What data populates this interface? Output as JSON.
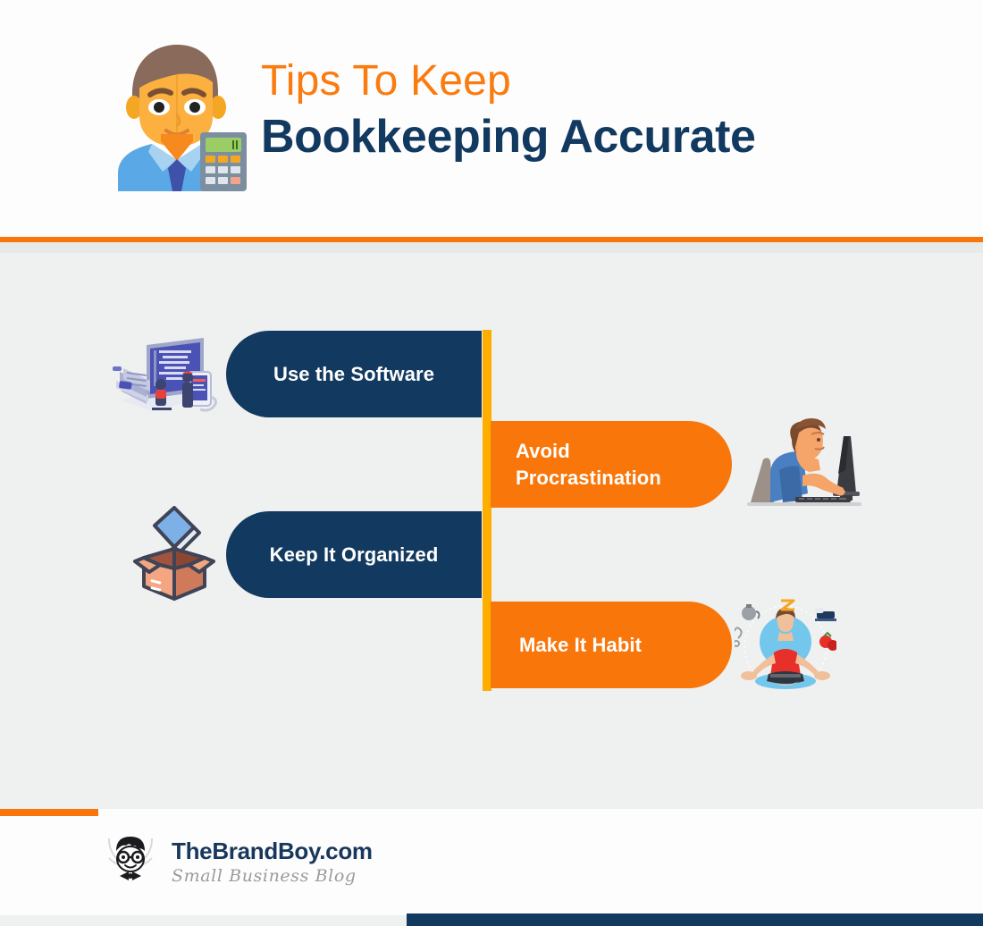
{
  "header": {
    "title_line1": "Tips To Keep",
    "title_line2": "Bookkeeping Accurate",
    "avatar_icon": "accountant-avatar-icon",
    "accent_color": "#f8760b",
    "title_color_primary": "#fa7b0f",
    "title_color_secondary": "#12395f"
  },
  "body": {
    "background_color": "#eff0f0",
    "spine_color": "#ffae00",
    "navy_color": "#12395f",
    "orange_color": "#f9760a",
    "cards": [
      {
        "label": "Use the Software",
        "style": "navy",
        "side": "left",
        "icon": "laptop-coding-illustration-icon"
      },
      {
        "label": "Avoid\nProcrastination",
        "style": "orange",
        "side": "right",
        "icon": "bored-person-at-computer-illustration-icon"
      },
      {
        "label": "Keep It Organized",
        "style": "navy",
        "side": "left",
        "icon": "open-box-with-book-illustration-icon"
      },
      {
        "label": "Make It Habit",
        "style": "orange",
        "side": "right",
        "icon": "meditating-person-habits-illustration-icon"
      }
    ]
  },
  "footer": {
    "brand_name": "TheBrandBoy.com",
    "brand_tagline": "Small Business Blog",
    "logo_icon": "brandboy-face-logo-icon",
    "accent_color": "#f8760b",
    "bar_color": "#12395f"
  }
}
